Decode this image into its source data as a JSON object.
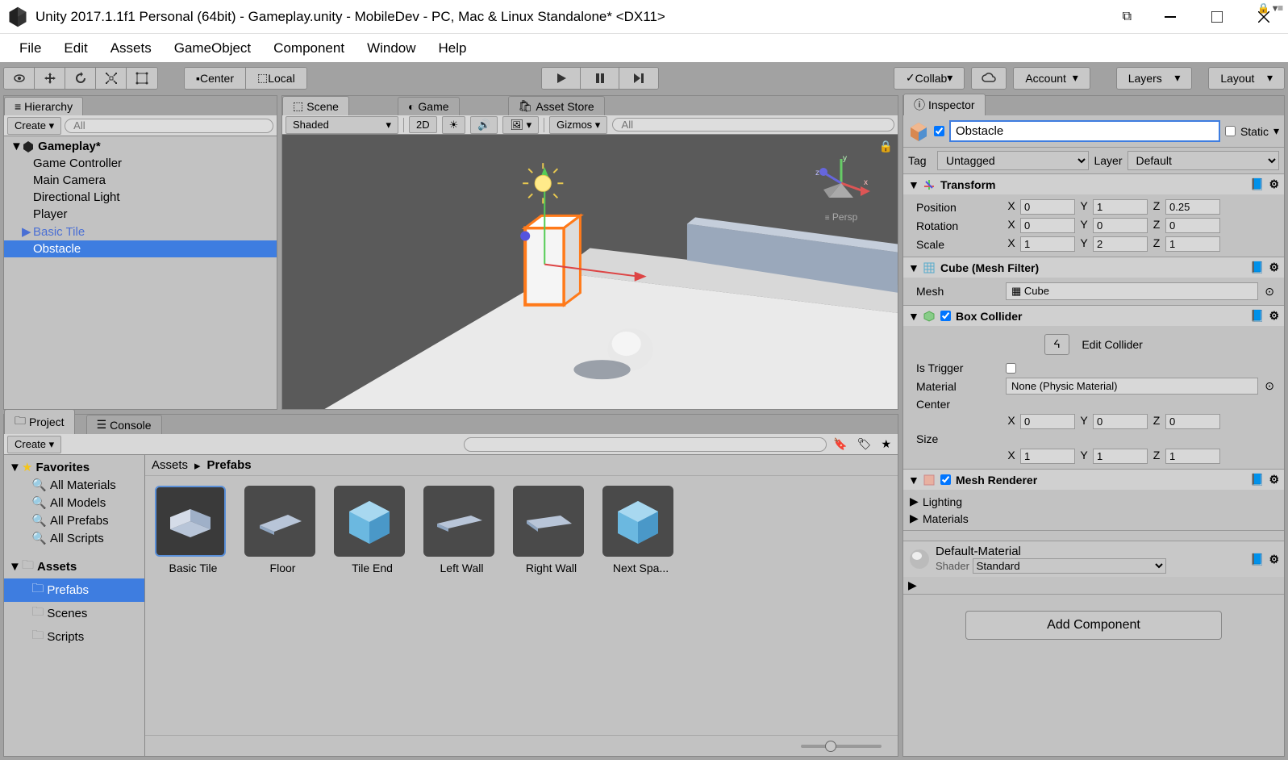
{
  "window": {
    "title": "Unity 2017.1.1f1 Personal (64bit) - Gameplay.unity - MobileDev - PC, Mac & Linux Standalone* <DX11>"
  },
  "menubar": [
    "File",
    "Edit",
    "Assets",
    "GameObject",
    "Component",
    "Window",
    "Help"
  ],
  "toolbar": {
    "pivot": "Center",
    "space": "Local",
    "collab": "Collab",
    "account": "Account",
    "layers": "Layers",
    "layout": "Layout"
  },
  "hierarchy": {
    "tab": "Hierarchy",
    "create": "Create",
    "search_placeholder": "All",
    "root": "Gameplay*",
    "items": [
      "Game Controller",
      "Main Camera",
      "Directional Light",
      "Player",
      "Basic Tile",
      "Obstacle"
    ]
  },
  "scene": {
    "tabs": [
      "Scene",
      "Game",
      "Asset Store"
    ],
    "shaded": "Shaded",
    "mode2d": "2D",
    "gizmos": "Gizmos",
    "search_placeholder": "All",
    "persp": "Persp"
  },
  "project": {
    "tabs": [
      "Project",
      "Console"
    ],
    "create": "Create",
    "favorites": "Favorites",
    "fav_items": [
      "All Materials",
      "All Models",
      "All Prefabs",
      "All Scripts"
    ],
    "assets": "Assets",
    "folders": [
      "Prefabs",
      "Scenes",
      "Scripts"
    ],
    "breadcrumb": [
      "Assets",
      "Prefabs"
    ],
    "prefabs": [
      "Basic Tile",
      "Floor",
      "Tile End",
      "Left Wall",
      "Right Wall",
      "Next Spa..."
    ]
  },
  "inspector": {
    "tab": "Inspector",
    "name": "Obstacle",
    "static": "Static",
    "tag_label": "Tag",
    "tag_value": "Untagged",
    "layer_label": "Layer",
    "layer_value": "Default",
    "transform": {
      "title": "Transform",
      "position": {
        "label": "Position",
        "x": "0",
        "y": "1",
        "z": "0.25"
      },
      "rotation": {
        "label": "Rotation",
        "x": "0",
        "y": "0",
        "z": "0"
      },
      "scale": {
        "label": "Scale",
        "x": "1",
        "y": "2",
        "z": "1"
      }
    },
    "mesh_filter": {
      "title": "Cube (Mesh Filter)",
      "mesh_label": "Mesh",
      "mesh_value": "Cube"
    },
    "box_collider": {
      "title": "Box Collider",
      "edit_collider": "Edit Collider",
      "is_trigger": "Is Trigger",
      "material_label": "Material",
      "material_value": "None (Physic Material)",
      "center_label": "Center",
      "center": {
        "x": "0",
        "y": "0",
        "z": "0"
      },
      "size_label": "Size",
      "size": {
        "x": "1",
        "y": "1",
        "z": "1"
      }
    },
    "mesh_renderer": {
      "title": "Mesh Renderer",
      "lighting": "Lighting",
      "materials": "Materials"
    },
    "material": {
      "name": "Default-Material",
      "shader_label": "Shader",
      "shader_value": "Standard"
    },
    "add_component": "Add Component"
  }
}
